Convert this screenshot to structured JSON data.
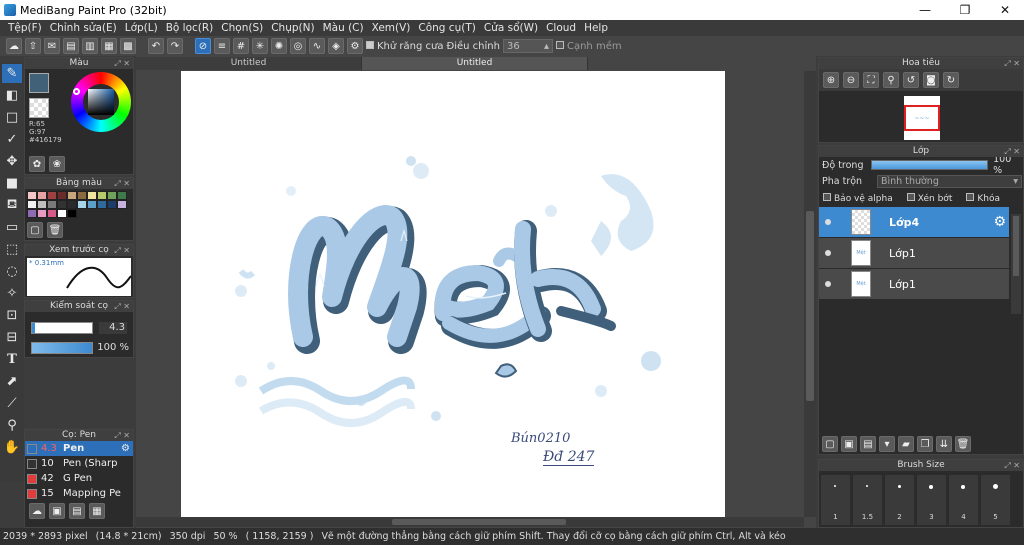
{
  "window": {
    "title": "MediBang Paint Pro (32bit)"
  },
  "menu": [
    "Tệp(F)",
    "Chỉnh sửa(E)",
    "Lớp(L)",
    "Bộ lọc(R)",
    "Chọn(S)",
    "Chụp(N)",
    "Màu (C)",
    "Xem(V)",
    "Công cụ(T)",
    "Cửa sổ(W)",
    "Cloud",
    "Help"
  ],
  "toolbar": {
    "antialias_label": "Khử răng cưa",
    "adjust_label": "Điều chỉnh",
    "adjust_value": "36",
    "smooth_edge_label": "Cạnh mềm"
  },
  "tabs": [
    "Untitled",
    "Untitled"
  ],
  "color_panel": {
    "title": "Màu",
    "r": "R:65",
    "g": "G:97",
    "hex": "#416179",
    "fg_color": "#416179"
  },
  "palette_panel": {
    "title": "Bảng màu",
    "colors": [
      "#f4c6c6",
      "#e8a2a2",
      "#a04040",
      "#6b2b2b",
      "#c9a57c",
      "#8a6a3e",
      "#f1e4a0",
      "#b7c96b",
      "#6fa35a",
      "#3f7a4a",
      "#f2f2f2",
      "#bfbfbf",
      "#7a7a7a",
      "#333333",
      "#2a2a2a",
      "#a7d4e8",
      "#5aa0c8",
      "#2f6a9c",
      "#1c3d6a",
      "#c8b2e0",
      "#8e6cb4",
      "#e89ac0",
      "#d85a8a",
      "#ffffff",
      "#000000"
    ]
  },
  "brush_preview": {
    "title": "Xem trước cọ",
    "size_text": "0.31mm"
  },
  "brush_control": {
    "title": "Kiểm soát cọ",
    "size_value": "4.3",
    "opacity_value": "100 %"
  },
  "brush_list": {
    "title": "Cọ: Pen",
    "items": [
      {
        "size": "4.3",
        "name": "Pen",
        "color": "#2d6fb8"
      },
      {
        "size": "10",
        "name": "Pen (Sharp",
        "color": "#333333"
      },
      {
        "size": "42",
        "name": "G Pen",
        "color": "#e03c3c"
      },
      {
        "size": "15",
        "name": "Mapping Pe",
        "color": "#e03c3c"
      }
    ]
  },
  "navigator": {
    "title": "Hoa tiêu"
  },
  "layer_panel": {
    "title": "Lớp",
    "opacity_label": "Độ trong",
    "opacity_value": "100 %",
    "blend_label": "Pha trộn",
    "blend_value": "Bình thường",
    "alpha_protect": "Bảo vệ alpha",
    "clip": "Xén bớt",
    "lock": "Khóa",
    "layers": [
      "Lớp4",
      "Lớp1",
      "Lớp1"
    ]
  },
  "brush_size_panel": {
    "title": "Brush Size",
    "labels": [
      "1",
      "1.5",
      "2",
      "3",
      "4",
      "5"
    ]
  },
  "artwork": {
    "title_text": "Mệt",
    "signature_line1": "Bún0210",
    "signature_line2": "Đđ 247"
  },
  "status": {
    "size": "2039 * 2893 pixel",
    "physical": "(14.8 * 21cm)",
    "dpi": "350 dpi",
    "zoom": "50 %",
    "coords": "( 1158, 2159 )",
    "hint": "Vẽ một đường thẳng bằng cách giữ phím Shift. Thay đổi cỡ cọ bằng cách giữ phím Ctrl, Alt và kéo"
  }
}
